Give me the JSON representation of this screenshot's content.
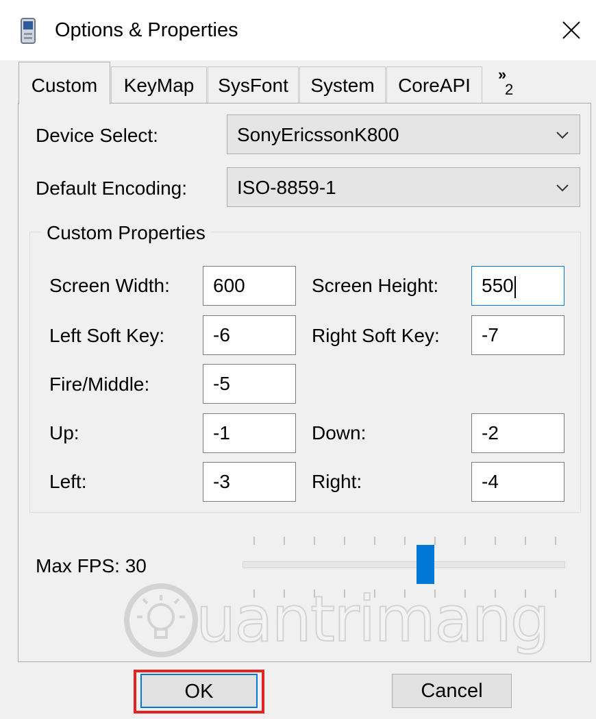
{
  "window": {
    "title": "Options & Properties",
    "icon": "device-phone-icon",
    "close_icon": "close-icon"
  },
  "tabs": [
    {
      "label": "Custom",
      "active": true
    },
    {
      "label": "KeyMap",
      "active": false
    },
    {
      "label": "SysFont",
      "active": false
    },
    {
      "label": "System",
      "active": false
    },
    {
      "label": "CoreAPI",
      "active": false
    }
  ],
  "tab_overflow": {
    "glyph": "»",
    "count": "2"
  },
  "device_select": {
    "label": "Device Select:",
    "value": "SonyEricssonK800"
  },
  "default_encoding": {
    "label": "Default Encoding:",
    "value": "ISO-8859-1"
  },
  "custom_properties": {
    "title": "Custom Properties",
    "screen_width": {
      "label": "Screen Width:",
      "value": "600"
    },
    "screen_height": {
      "label": "Screen Height:",
      "value": "550"
    },
    "left_soft_key": {
      "label": "Left Soft Key:",
      "value": "-6"
    },
    "right_soft_key": {
      "label": "Right Soft Key:",
      "value": "-7"
    },
    "fire_middle": {
      "label": "Fire/Middle:",
      "value": "-5"
    },
    "up": {
      "label": "Up:",
      "value": "-1"
    },
    "down": {
      "label": "Down:",
      "value": "-2"
    },
    "left": {
      "label": "Left:",
      "value": "-3"
    },
    "right": {
      "label": "Right:",
      "value": "-4"
    }
  },
  "max_fps": {
    "label": "Max FPS: 30",
    "slider_fraction": 0.57
  },
  "buttons": {
    "ok": "OK",
    "cancel": "Cancel"
  },
  "watermark": {
    "text": "uantrimang"
  },
  "colors": {
    "accent": "#0078d7",
    "highlight": "#e32222"
  }
}
